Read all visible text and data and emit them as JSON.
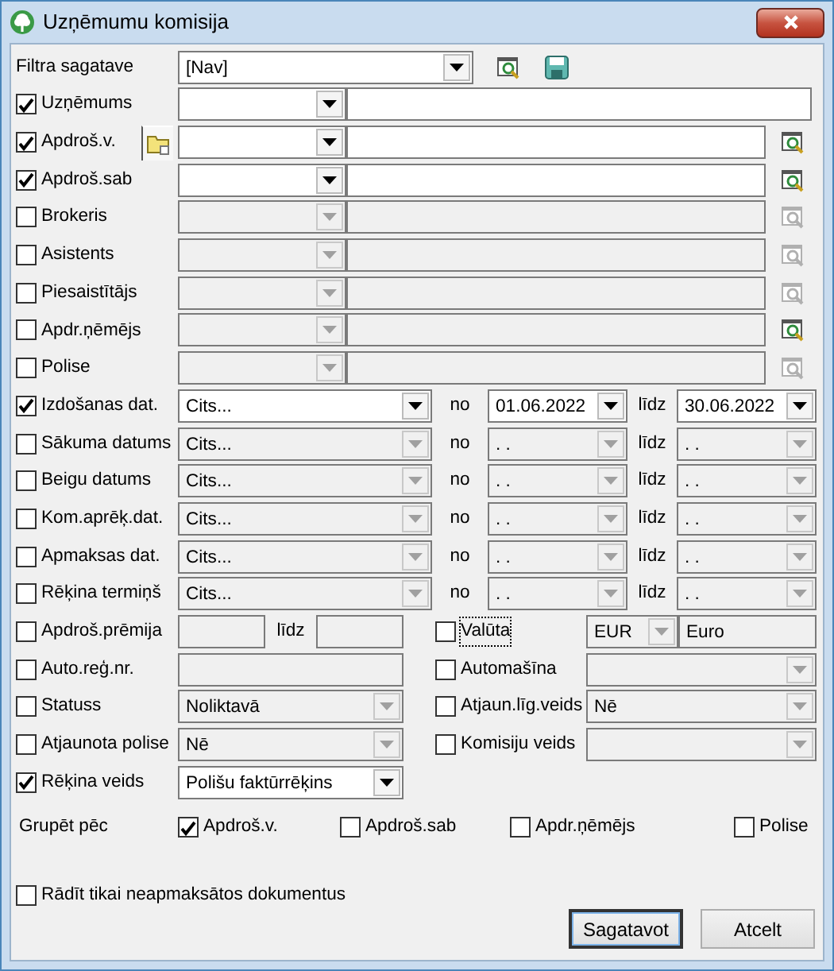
{
  "window": {
    "title": "Uzņēmumu komisija"
  },
  "template": {
    "label": "Filtra sagatave",
    "value": "[Nav]"
  },
  "lookups": [
    {
      "label": "Uzņēmums",
      "checked": true
    },
    {
      "label": "Apdroš.v.",
      "checked": true,
      "folder_button": true,
      "search_enabled": true
    },
    {
      "label": "Apdroš.sab",
      "checked": true,
      "search_enabled": true
    },
    {
      "label": "Brokeris",
      "checked": false,
      "search_enabled": false
    },
    {
      "label": "Asistents",
      "checked": false,
      "search_enabled": false
    },
    {
      "label": "Piesaistītājs",
      "checked": false,
      "search_enabled": false
    },
    {
      "label": "Apdr.ņēmējs",
      "checked": false,
      "search_enabled": true
    },
    {
      "label": "Polise",
      "checked": false,
      "search_enabled": false
    }
  ],
  "dates": [
    {
      "label": "Izdošanas dat.",
      "checked": true,
      "period": "Cits...",
      "from_label": "no",
      "from": "01.06.2022",
      "to_label": "līdz",
      "to": "30.06.2022"
    },
    {
      "label": "Sākuma datums",
      "checked": false,
      "period": "Cits...",
      "from_label": "no",
      "from": ". .",
      "to_label": "līdz",
      "to": ". ."
    },
    {
      "label": "Beigu datums",
      "checked": false,
      "period": "Cits...",
      "from_label": "no",
      "from": ". .",
      "to_label": "līdz",
      "to": ". ."
    },
    {
      "label": "Kom.aprēķ.dat.",
      "checked": false,
      "period": "Cits...",
      "from_label": "no",
      "from": ". .",
      "to_label": "līdz",
      "to": ". ."
    },
    {
      "label": "Apmaksas dat.",
      "checked": false,
      "period": "Cits...",
      "from_label": "no",
      "from": ". .",
      "to_label": "līdz",
      "to": ". ."
    },
    {
      "label": "Rēķina termiņš",
      "checked": false,
      "period": "Cits...",
      "from_label": "no",
      "from": ". .",
      "to_label": "līdz",
      "to": ". ."
    }
  ],
  "pairs": [
    {
      "left": {
        "kind": "range",
        "label": "Apdroš.prēmija",
        "checked": false,
        "to_label": "līdz"
      },
      "right": {
        "kind": "currency",
        "label": "Valūta",
        "checked": false,
        "focused": true,
        "code": "EUR",
        "name": "Euro"
      }
    },
    {
      "left": {
        "kind": "text",
        "label": "Auto.reģ.nr.",
        "checked": false
      },
      "right": {
        "kind": "combo",
        "label": "Automašīna",
        "checked": false
      }
    },
    {
      "left": {
        "kind": "combo",
        "label": "Statuss",
        "checked": false,
        "value": "Noliktavā"
      },
      "right": {
        "kind": "combo",
        "label": "Atjaun.līg.veids",
        "checked": false,
        "value": "Nē"
      }
    },
    {
      "left": {
        "kind": "combo",
        "label": "Atjaunota polise",
        "checked": false,
        "value": "Nē"
      },
      "right": {
        "kind": "combo",
        "label": "Komisiju veids",
        "checked": false
      }
    },
    {
      "left": {
        "kind": "combo",
        "label": "Rēķina veids",
        "checked": true,
        "value": "Polišu faktūrrēķins"
      }
    }
  ],
  "group_by": {
    "label": "Grupēt pēc",
    "options": [
      {
        "label": "Apdroš.v.",
        "checked": true
      },
      {
        "label": "Apdroš.sab",
        "checked": false
      },
      {
        "label": "Apdr.ņēmējs",
        "checked": false
      },
      {
        "label": "Polise",
        "checked": false
      }
    ]
  },
  "unpaid_only": {
    "label": "Rādīt tikai neapmaksātos dokumentus",
    "checked": false
  },
  "buttons": [
    {
      "label": "Sagatavot",
      "default": true
    },
    {
      "label": "Atcelt",
      "default": false
    }
  ]
}
